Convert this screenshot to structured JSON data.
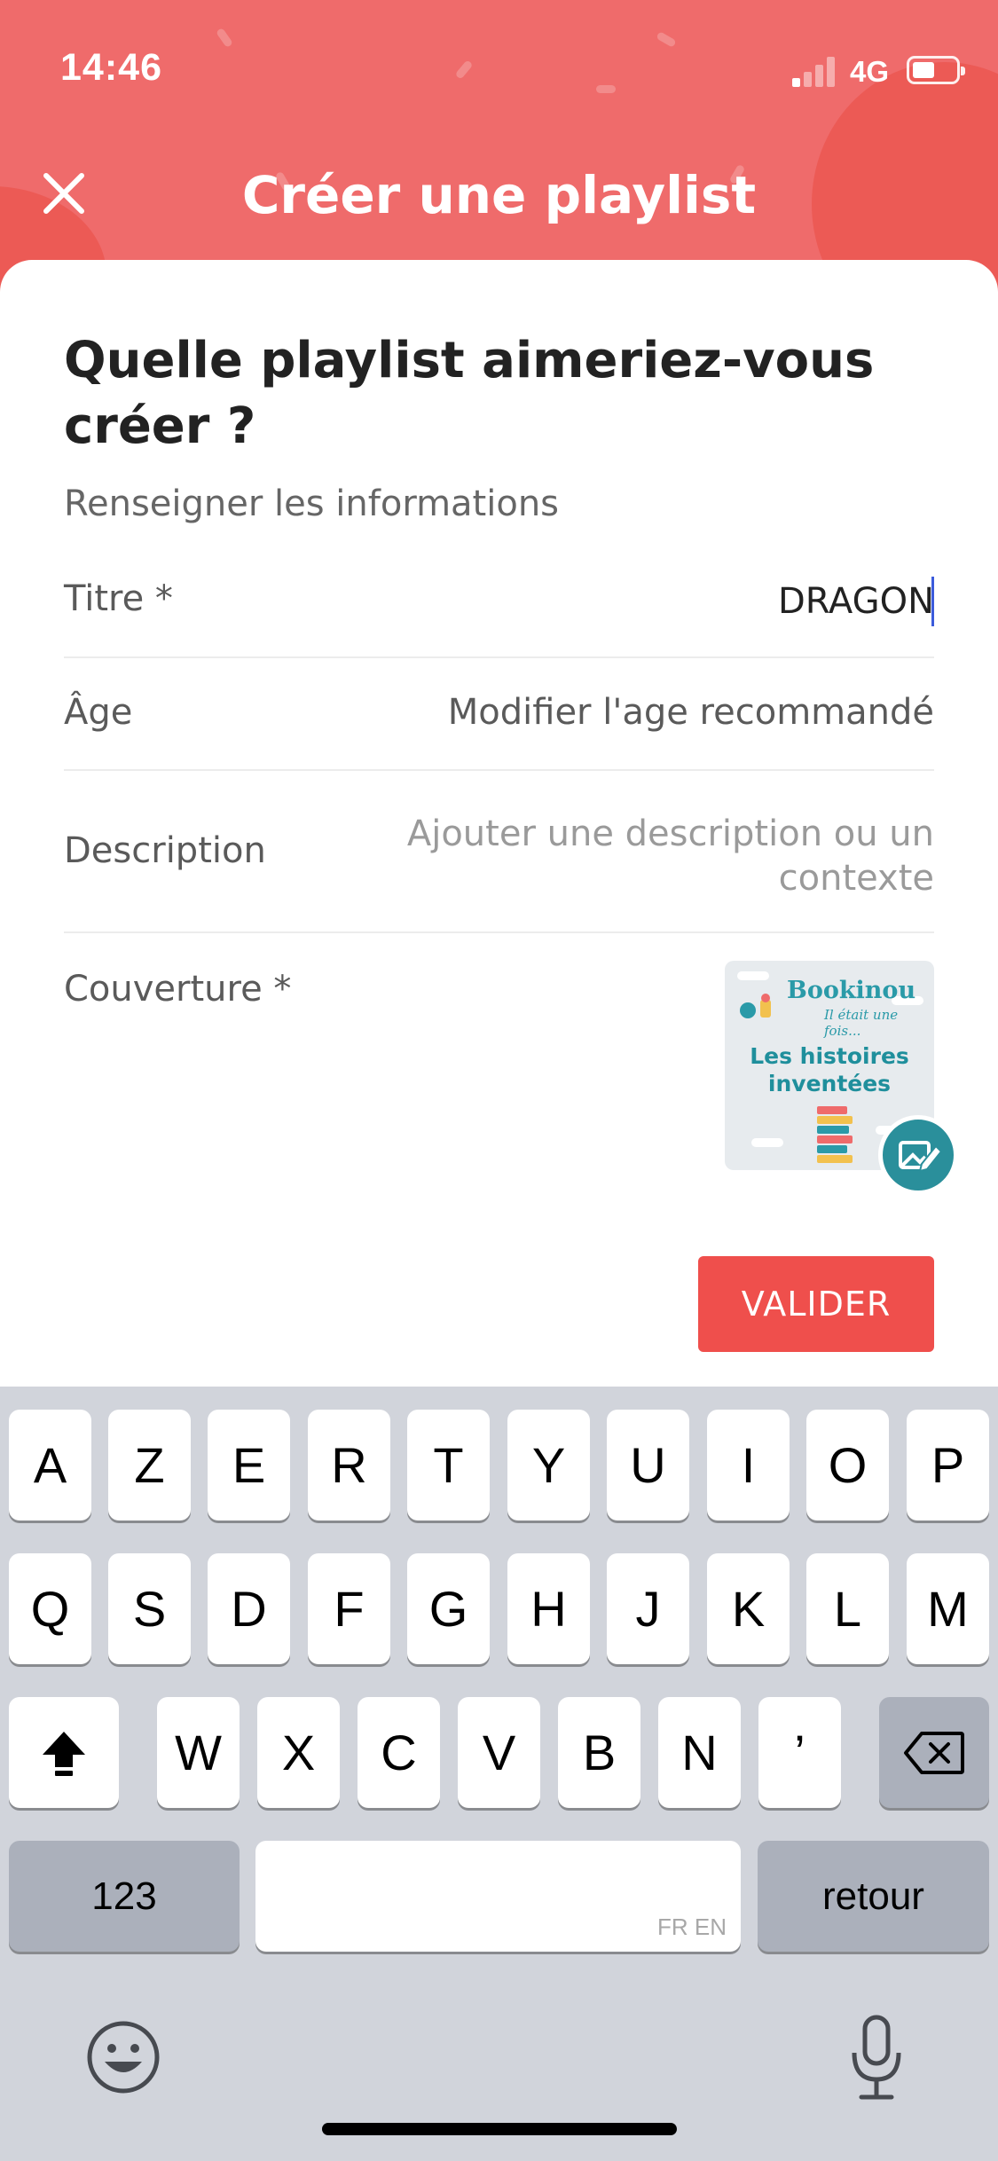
{
  "status_bar": {
    "time": "14:46",
    "network": "4G"
  },
  "header": {
    "title": "Créer une playlist",
    "close_icon": "close-icon"
  },
  "form": {
    "question": "Quelle playlist aimeriez-vous créer ?",
    "subtitle": "Renseigner les informations",
    "title_label": "Titre *",
    "title_value": "DRAGON",
    "age_label": "Âge",
    "age_value": "Modifier l'age recommandé",
    "description_label": "Description",
    "description_placeholder": "Ajouter une description ou un contexte",
    "cover_label": "Couverture *",
    "cover": {
      "brand": "Bookinou",
      "tagline": "Il était une fois...",
      "title": "Les histoires inventées",
      "edit_icon": "edit-image-icon"
    },
    "submit_label": "VALIDER"
  },
  "keyboard": {
    "row1": [
      "A",
      "Z",
      "E",
      "R",
      "T",
      "Y",
      "U",
      "I",
      "O",
      "P"
    ],
    "row2": [
      "Q",
      "S",
      "D",
      "F",
      "G",
      "H",
      "J",
      "K",
      "L",
      "M"
    ],
    "row3": [
      "W",
      "X",
      "C",
      "V",
      "B",
      "N",
      "’"
    ],
    "numbers_label": "123",
    "space_hint": "FR EN",
    "return_label": "retour",
    "shift_icon": "shift-icon",
    "delete_icon": "backspace-icon",
    "emoji_icon": "emoji-icon",
    "mic_icon": "microphone-icon"
  },
  "colors": {
    "header": "#ef6b6b",
    "accent": "#ef4f4c",
    "teal": "#2a8f9b"
  }
}
